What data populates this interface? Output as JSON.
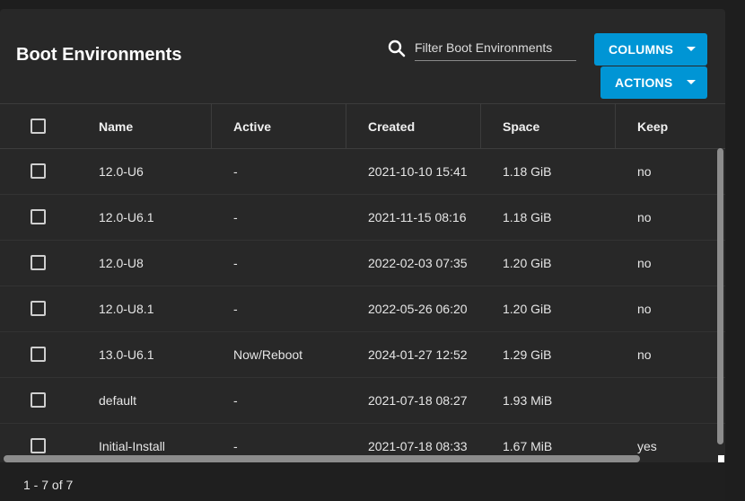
{
  "header": {
    "title": "Boot Environments",
    "filter_placeholder": "Filter Boot Environments",
    "columns_label": "COLUMNS",
    "actions_label": "ACTIONS"
  },
  "table": {
    "columns": [
      "Name",
      "Active",
      "Created",
      "Space",
      "Keep"
    ],
    "rows": [
      {
        "name": "12.0-U6",
        "active": "-",
        "created": "2021-10-10 15:41",
        "space": "1.18 GiB",
        "keep": "no"
      },
      {
        "name": "12.0-U6.1",
        "active": "-",
        "created": "2021-11-15 08:16",
        "space": "1.18 GiB",
        "keep": "no"
      },
      {
        "name": "12.0-U8",
        "active": "-",
        "created": "2022-02-03 07:35",
        "space": "1.20 GiB",
        "keep": "no"
      },
      {
        "name": "12.0-U8.1",
        "active": "-",
        "created": "2022-05-26 06:20",
        "space": "1.20 GiB",
        "keep": "no"
      },
      {
        "name": "13.0-U6.1",
        "active": "Now/Reboot",
        "created": "2024-01-27 12:52",
        "space": "1.29 GiB",
        "keep": "no"
      },
      {
        "name": "default",
        "active": "-",
        "created": "2021-07-18 08:27",
        "space": "1.93 MiB",
        "keep": ""
      },
      {
        "name": "Initial-Install",
        "active": "-",
        "created": "2021-07-18 08:33",
        "space": "1.67 MiB",
        "keep": "yes"
      }
    ]
  },
  "footer": {
    "pager_text": "1 - 7 of 7"
  },
  "colors": {
    "accent": "#0095d5",
    "background": "#1e1e1e",
    "card": "#282828"
  }
}
